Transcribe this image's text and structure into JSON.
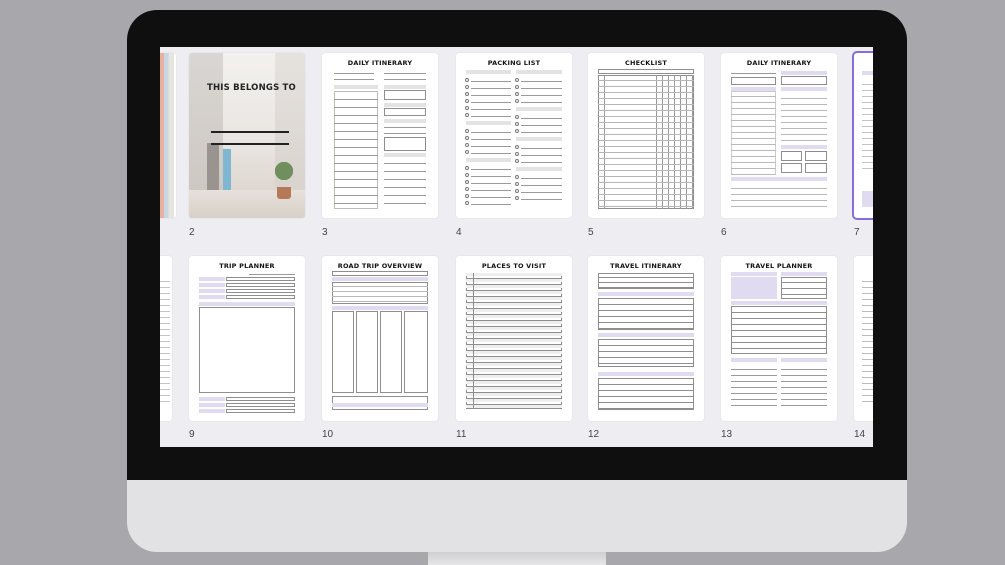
{
  "pages_row1": [
    {
      "num": "2",
      "title": "THIS BELONGS TO"
    },
    {
      "num": "3",
      "title": "DAILY ITINERARY"
    },
    {
      "num": "4",
      "title": "PACKING LIST"
    },
    {
      "num": "5",
      "title": "CHECKLIST"
    },
    {
      "num": "6",
      "title": "DAILY ITINERARY"
    },
    {
      "num": "7",
      "title": ""
    }
  ],
  "pages_row2": [
    {
      "num": "9",
      "title": "TRIP PLANNER"
    },
    {
      "num": "10",
      "title": "ROAD TRIP OVERVIEW"
    },
    {
      "num": "11",
      "title": "PLACES TO VISIT"
    },
    {
      "num": "12",
      "title": "TRAVEL ITINERARY"
    },
    {
      "num": "13",
      "title": "TRAVEL PLANNER"
    },
    {
      "num": "14",
      "title": ""
    }
  ],
  "colors": {
    "accent": "#8a6cd8",
    "lavender": "#e0dbf0",
    "bezel": "#0f0f10"
  }
}
